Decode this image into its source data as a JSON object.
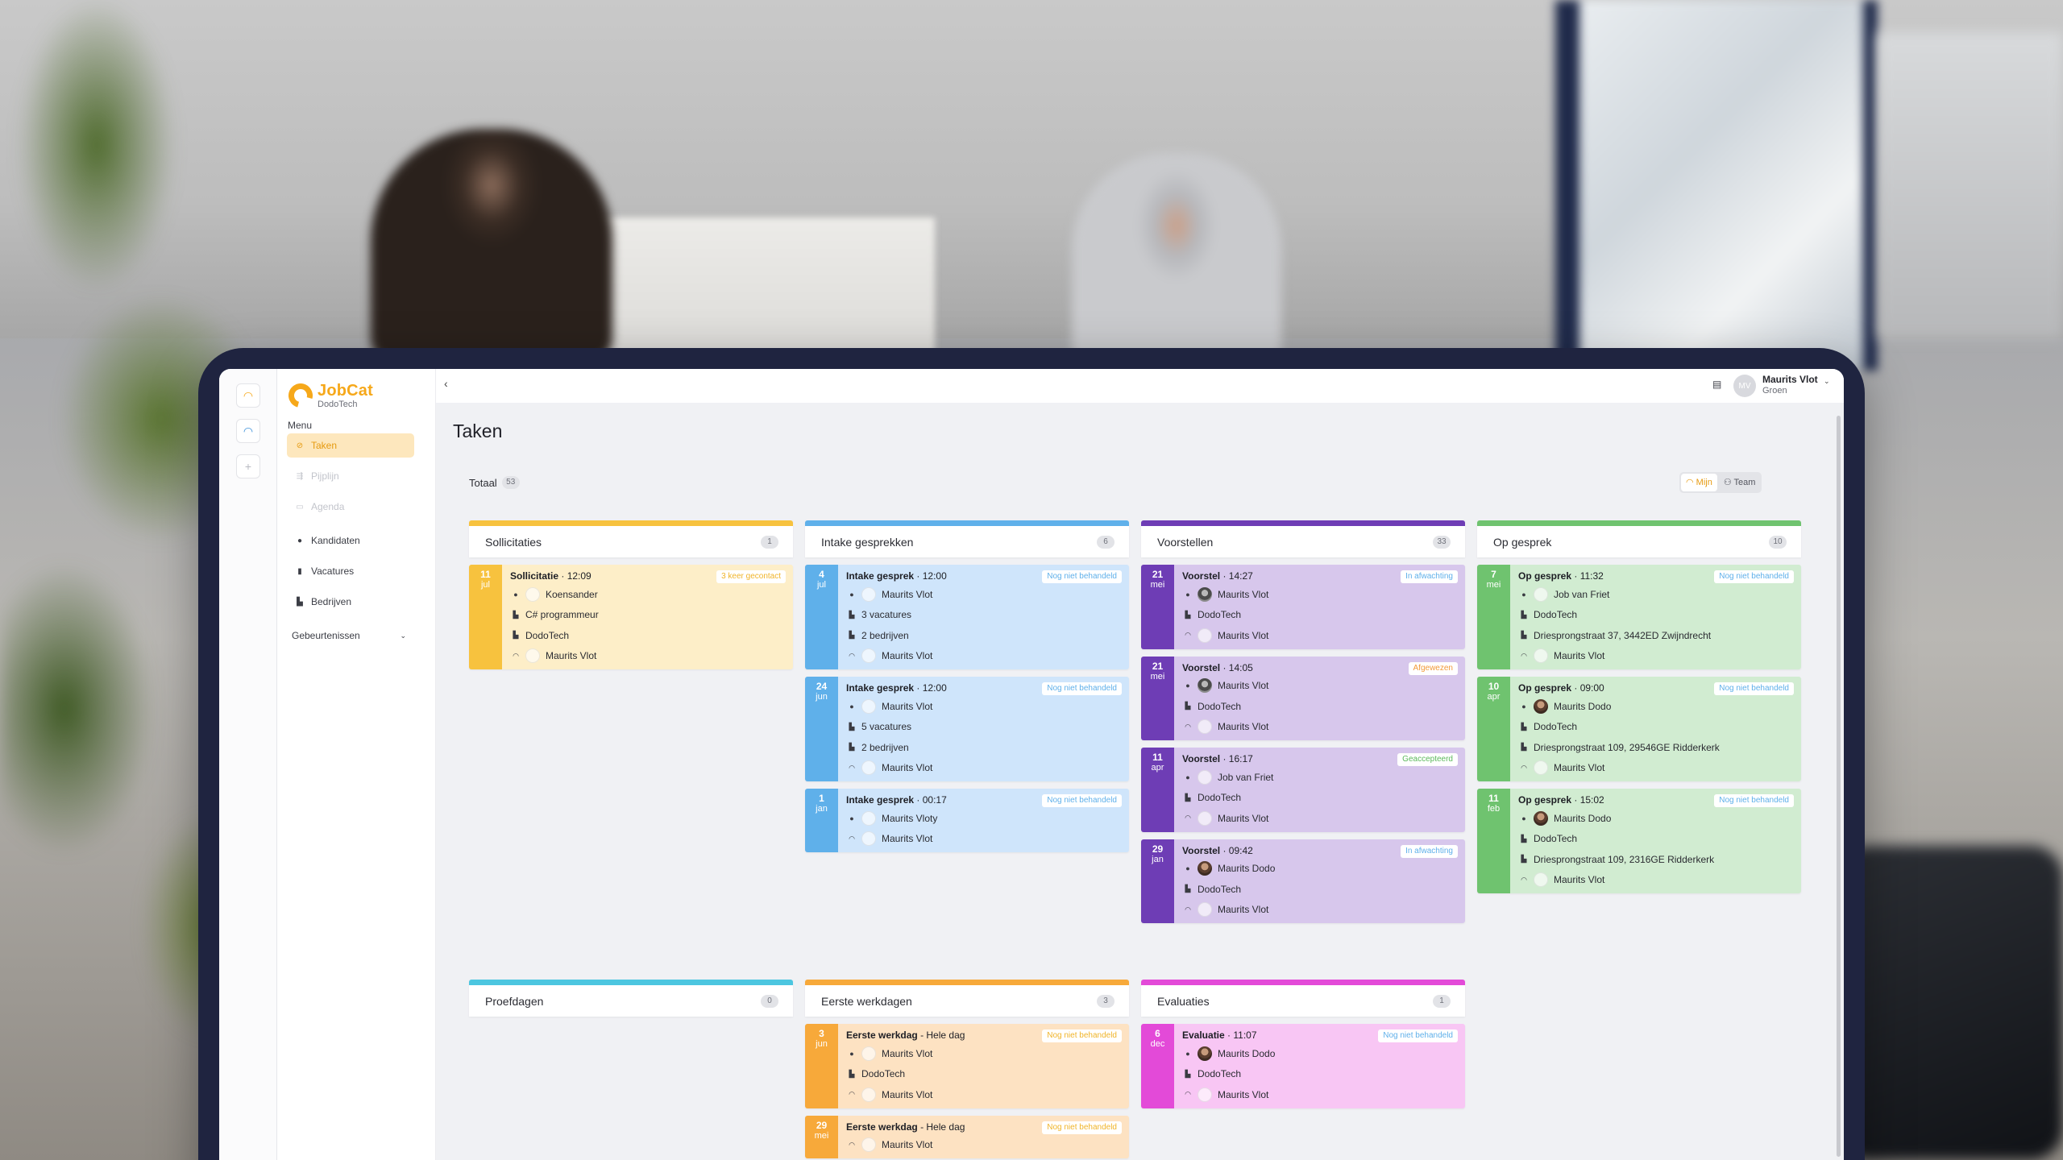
{
  "app": {
    "brand_name": "JobCat",
    "brand_sub": "DodoTech",
    "accent": "#f6a81a"
  },
  "sidebar": {
    "menu_title": "Menu",
    "items": [
      {
        "label": "Taken",
        "icon": "check-circle-icon"
      },
      {
        "label": "Pijplijn",
        "icon": "pipeline-icon"
      },
      {
        "label": "Agenda",
        "icon": "calendar-icon"
      },
      {
        "label": "Kandidaten",
        "icon": "person-icon"
      },
      {
        "label": "Vacatures",
        "icon": "document-icon"
      },
      {
        "label": "Bedrijven",
        "icon": "building-icon"
      },
      {
        "label": "Gebeurtenissen",
        "icon": "chevron-down-icon"
      }
    ]
  },
  "topbar": {
    "user_initials": "MV",
    "user_name": "Maurits Vlot",
    "user_team": "Groen"
  },
  "main": {
    "title": "Taken",
    "total_label": "Totaal",
    "total_count": "53",
    "scope_mine": "Mijn",
    "scope_team": "Team"
  },
  "columns": [
    {
      "title": "Sollicitaties",
      "count": "1",
      "color": "#f7c23e",
      "cards": [
        {
          "day": "11",
          "month": "jul",
          "type": "Sollicitatie",
          "time": "· 12:09",
          "badge": "3 keer gecontact",
          "badge_color": "#f0b429",
          "rows": [
            "Koensander",
            "C# programmeur",
            "DodoTech",
            "Maurits Vlot"
          ]
        }
      ]
    },
    {
      "title": "Intake gesprekken",
      "count": "6",
      "color": "#5fb0ea",
      "cards": [
        {
          "day": "4",
          "month": "jul",
          "type": "Intake gesprek",
          "time": "· 12:00",
          "badge": "Nog niet behandeld",
          "badge_color": "#5fb0ea",
          "rows": [
            "Maurits Vlot",
            "3 vacatures",
            "2 bedrijven",
            "Maurits Vlot"
          ]
        },
        {
          "day": "24",
          "month": "jun",
          "type": "Intake gesprek",
          "time": "· 12:00",
          "badge": "Nog niet behandeld",
          "badge_color": "#5fb0ea",
          "rows": [
            "Maurits Vlot",
            "5 vacatures",
            "2 bedrijven",
            "Maurits Vlot"
          ]
        },
        {
          "day": "1",
          "month": "jan",
          "type": "Intake gesprek",
          "time": "· 00:17",
          "badge": "Nog niet behandeld",
          "badge_color": "#5fb0ea",
          "rows": [
            "Maurits Vloty",
            "Maurits Vlot"
          ]
        }
      ]
    },
    {
      "title": "Voorstellen",
      "count": "33",
      "color": "#6e3db5",
      "cards": [
        {
          "day": "21",
          "month": "mei",
          "type": "Voorstel",
          "time": "· 14:27",
          "badge": "In afwachting",
          "badge_color": "#5fb0ea",
          "rows": [
            "Maurits Vlot",
            "DodoTech",
            "Maurits Vlot"
          ]
        },
        {
          "day": "21",
          "month": "mei",
          "type": "Voorstel",
          "time": "· 14:05",
          "badge": "Afgewezen",
          "badge_color": "#f29a3a",
          "rows": [
            "Maurits Vlot",
            "DodoTech",
            "Maurits Vlot"
          ]
        },
        {
          "day": "11",
          "month": "apr",
          "type": "Voorstel",
          "time": "· 16:17",
          "badge": "Geaccepteerd",
          "badge_color": "#5cb85c",
          "rows": [
            "Job van Friet",
            "DodoTech",
            "Maurits Vlot"
          ]
        },
        {
          "day": "29",
          "month": "jan",
          "type": "Voorstel",
          "time": "· 09:42",
          "badge": "In afwachting",
          "badge_color": "#5fb0ea",
          "rows": [
            "Maurits Dodo",
            "DodoTech",
            "Maurits Vlot"
          ]
        }
      ]
    },
    {
      "title": "Op gesprek",
      "count": "10",
      "color": "#6fc36f",
      "cards": [
        {
          "day": "7",
          "month": "mei",
          "type": "Op gesprek",
          "time": "· 11:32",
          "badge": "Nog niet behandeld",
          "badge_color": "#5fb0ea",
          "rows": [
            "Job van Friet",
            "DodoTech",
            "Driesprongstraat 37, 3442ED Zwijndrecht",
            "Maurits Vlot"
          ]
        },
        {
          "day": "10",
          "month": "apr",
          "type": "Op gesprek",
          "time": "· 09:00",
          "badge": "Nog niet behandeld",
          "badge_color": "#5fb0ea",
          "rows": [
            "Maurits Dodo",
            "DodoTech",
            "Driesprongstraat 109, 29546GE Ridderkerk",
            "Maurits Vlot"
          ]
        },
        {
          "day": "11",
          "month": "feb",
          "type": "Op gesprek",
          "time": "· 15:02",
          "badge": "Nog niet behandeld",
          "badge_color": "#5fb0ea",
          "rows": [
            "Maurits Dodo",
            "DodoTech",
            "Driesprongstraat 109, 2316GE Ridderkerk",
            "Maurits Vlot"
          ]
        }
      ]
    },
    {
      "title": "Proefdagen",
      "count": "0",
      "color": "#4cc6e0",
      "cards": []
    },
    {
      "title": "Eerste werkdagen",
      "count": "3",
      "color": "#f7a93a",
      "cards": [
        {
          "day": "3",
          "month": "jun",
          "type": "Eerste werkdag",
          "time": "- Hele dag",
          "badge": "Nog niet behandeld",
          "badge_color": "#f0b429",
          "rows": [
            "Maurits Vlot",
            "DodoTech",
            "Maurits Vlot"
          ]
        },
        {
          "day": "29",
          "month": "mei",
          "type": "Eerste werkdag",
          "time": "- Hele dag",
          "badge": "Nog niet behandeld",
          "badge_color": "#f0b429",
          "rows": [
            "Maurits Vlot"
          ]
        }
      ]
    },
    {
      "title": "Evaluaties",
      "count": "1",
      "color": "#e34ad8",
      "cards": [
        {
          "day": "6",
          "month": "dec",
          "type": "Evaluatie",
          "time": "· 11:07",
          "badge": "Nog niet behandeld",
          "badge_color": "#5fb0ea",
          "rows": [
            "Maurits Dodo",
            "DodoTech",
            "Maurits Vlot"
          ]
        }
      ]
    }
  ]
}
